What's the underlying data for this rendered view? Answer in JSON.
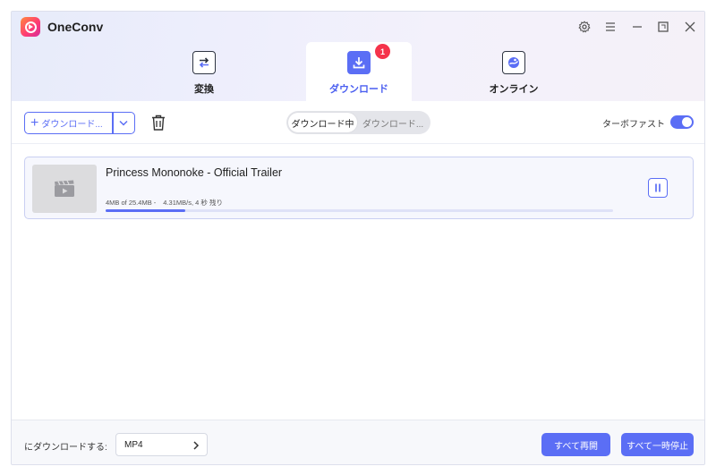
{
  "app": {
    "title": "OneConv"
  },
  "tabs": [
    {
      "label": "変換",
      "icon": "convert-icon",
      "active": false
    },
    {
      "label": "ダウンロード",
      "icon": "download-icon",
      "active": true,
      "badge": "1"
    },
    {
      "label": "オンライン",
      "icon": "online-icon",
      "active": false
    }
  ],
  "toolbar": {
    "add_download_label": "ダウンロード...",
    "segments": [
      {
        "label": "ダウンロード中",
        "active": true
      },
      {
        "label": "ダウンロード...",
        "active": false
      }
    ],
    "turbo_label": "ターボファスト",
    "turbo_on": true
  },
  "downloads": [
    {
      "title": "Princess Mononoke - Official Trailer",
      "size_progress": "4MB of 25.4MB -",
      "speed_eta": "4.31MB/s, 4 秒 残り",
      "progress": 0.157
    }
  ],
  "footer": {
    "format_label": "にダウンロードする:",
    "format_value": "MP4",
    "resume_all_label": "すべて再開",
    "pause_all_label": "すべて一時停止"
  },
  "colors": {
    "accent": "#5b6ef5",
    "badge": "#f5334b"
  }
}
